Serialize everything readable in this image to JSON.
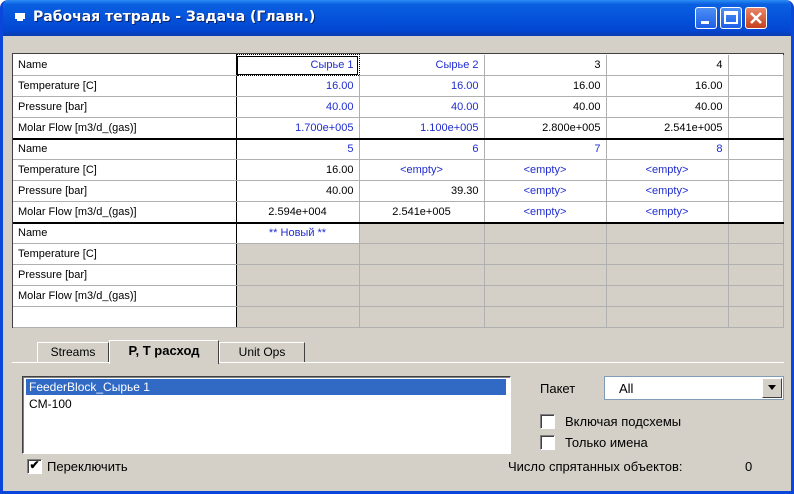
{
  "window": {
    "title": "Рабочая тетрадь - Задача (Главн.)"
  },
  "grid": {
    "rows_labels": [
      "Name",
      "Temperature [C]",
      "Pressure [bar]",
      "Molar Flow [m3/d_(gas)]"
    ],
    "block1": {
      "names": [
        "Сырье 1",
        "Сырье 2",
        "3",
        "4"
      ],
      "temperature": [
        "16.00",
        "16.00",
        "16.00",
        "16.00"
      ],
      "pressure": [
        "40.00",
        "40.00",
        "40.00",
        "40.00"
      ],
      "flow": [
        "1.700e+005",
        "1.100e+005",
        "2.800e+005",
        "2.541e+005"
      ]
    },
    "block2": {
      "names": [
        "5",
        "6",
        "7",
        "8"
      ],
      "temperature": [
        "16.00",
        "<empty>",
        "<empty>",
        "<empty>"
      ],
      "pressure": [
        "40.00",
        "39.30",
        "<empty>",
        "<empty>"
      ],
      "flow": [
        "2.594e+004",
        "2.541e+005",
        "<empty>",
        "<empty>"
      ]
    },
    "block3": {
      "names": [
        "** Новый **",
        "",
        "",
        ""
      ]
    }
  },
  "tabs": [
    {
      "label": "Streams"
    },
    {
      "label": "P, T расход"
    },
    {
      "label": "Unit Ops"
    }
  ],
  "list": {
    "items": [
      "FeederBlock_Сырье 1",
      "CM-100"
    ],
    "selected_index": 0
  },
  "packet": {
    "label": "Пакет",
    "value": "All"
  },
  "options": {
    "include_subschemes": "Включая подсхемы",
    "names_only": "Только имена",
    "switch_label": "Переключить",
    "switch_checked": "✔",
    "hidden_label": "Число спрятанных объектов:",
    "hidden_count": "0"
  },
  "colors": {
    "titlebar": "#0553da",
    "value_blue": "#1f2ccf",
    "selection": "#316ac5"
  }
}
